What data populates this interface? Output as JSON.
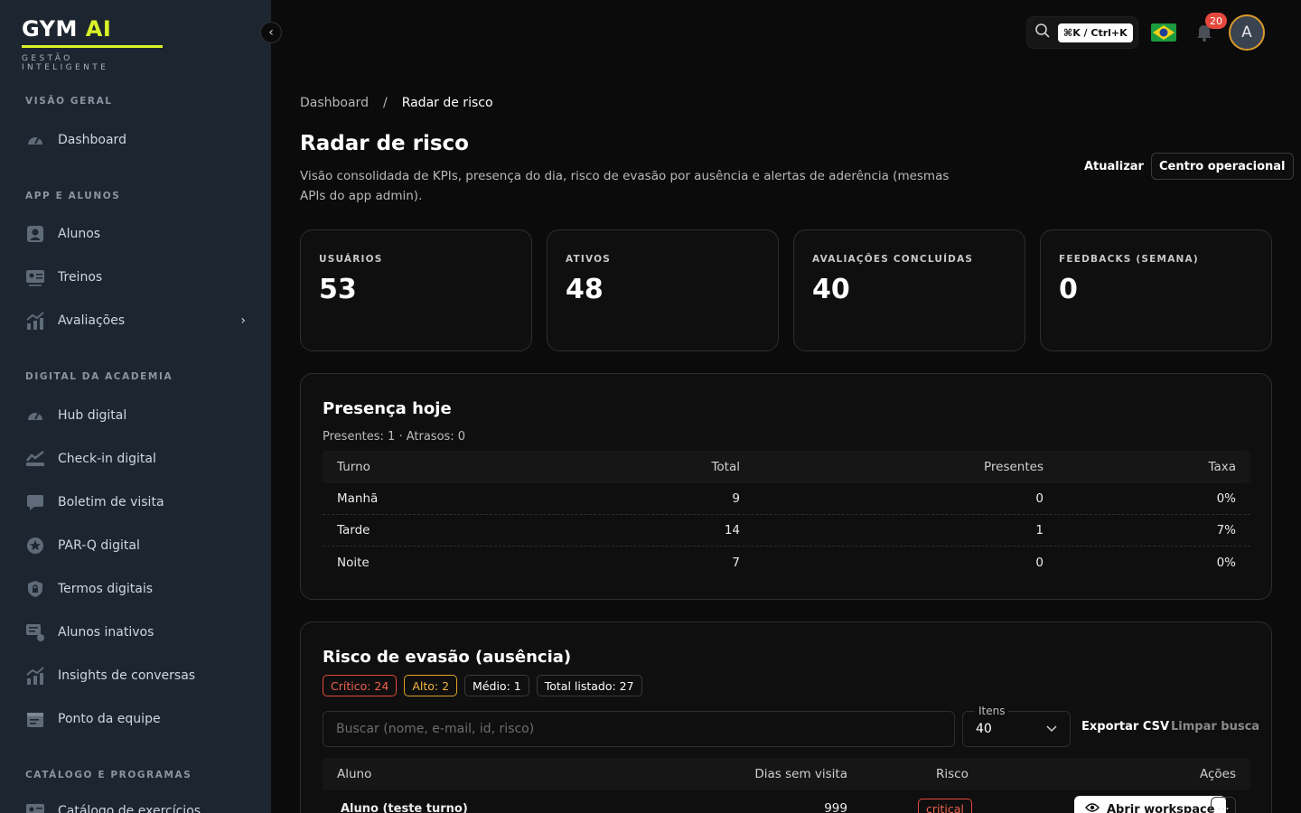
{
  "brand": {
    "name_main": "GYM",
    "name_accent": "AI",
    "tagline": "GESTÃO INTELIGENTE",
    "accent_color": "#d9f227"
  },
  "sidebar": {
    "collapse_icon": "‹",
    "sections": [
      {
        "title": "VISÃO GERAL",
        "items": [
          {
            "label": "Dashboard",
            "icon": "gauge-icon"
          }
        ]
      },
      {
        "title": "APP E ALUNOS",
        "items": [
          {
            "label": "Alunos",
            "icon": "user-icon"
          },
          {
            "label": "Treinos",
            "icon": "id-card-icon"
          },
          {
            "label": "Avaliações",
            "icon": "chart-icon",
            "has_submenu": true
          }
        ]
      },
      {
        "title": "DIGITAL DA ACADEMIA",
        "items": [
          {
            "label": "Hub digital",
            "icon": "gauge-icon"
          },
          {
            "label": "Check-in digital",
            "icon": "checkin-icon"
          },
          {
            "label": "Boletim de visita",
            "icon": "chat-icon"
          },
          {
            "label": "PAR-Q digital",
            "icon": "star-icon"
          },
          {
            "label": "Termos digitais",
            "icon": "lock-icon"
          },
          {
            "label": "Alunos inativos",
            "icon": "message-icon"
          },
          {
            "label": "Insights de conversas",
            "icon": "chart-icon"
          },
          {
            "label": "Ponto da equipe",
            "icon": "calendar-icon"
          }
        ]
      },
      {
        "title": "CATÁLOGO E PROGRAMAS",
        "items": [
          {
            "label": "Catálogo de exercícios",
            "icon": "id-card-icon"
          }
        ]
      }
    ]
  },
  "topbar": {
    "shortcut": "⌘K / Ctrl+K",
    "notifications": "20",
    "avatar_initial": "A"
  },
  "breadcrumb": {
    "root": "Dashboard",
    "separator": "/",
    "current": "Radar de risco"
  },
  "page": {
    "title": "Radar de risco",
    "description": "Visão consolidada de KPIs, presença do dia, risco de evasão por ausência e alertas de aderência (mesmas APIs do app admin).",
    "refresh_label": "Atualizar",
    "center_label": "Centro operacional"
  },
  "kpis": [
    {
      "label": "USUÁRIOS",
      "value": "53"
    },
    {
      "label": "ATIVOS",
      "value": "48"
    },
    {
      "label": "AVALIAÇÕES CONCLUÍDAS",
      "value": "40"
    },
    {
      "label": "FEEDBACKS (SEMANA)",
      "value": "0"
    }
  ],
  "presence": {
    "title": "Presença hoje",
    "summary": "Presentes: 1 · Atrasos: 0",
    "columns": [
      "Turno",
      "Total",
      "Presentes",
      "Taxa"
    ],
    "rows": [
      [
        "Manhã",
        "9",
        "0",
        "0%"
      ],
      [
        "Tarde",
        "14",
        "1",
        "7%"
      ],
      [
        "Noite",
        "7",
        "0",
        "0%"
      ]
    ]
  },
  "risk": {
    "title": "Risco de evasão (ausência)",
    "chips": {
      "critical": "Crítico: 24",
      "high": "Alto: 2",
      "medium": "Médio: 1",
      "total": "Total listado: 27"
    },
    "search_placeholder": "Buscar (nome, e-mail, id, risco)",
    "items_label": "Itens",
    "items_value": "40",
    "export_label": "Exportar CSV",
    "clear_label": "Limpar busca",
    "columns": [
      "Aluno",
      "Dias sem visita",
      "Risco",
      "Ações"
    ],
    "rows": [
      {
        "student": "Aluno (teste turno)",
        "days": "999",
        "risk": "critical",
        "action": "Abrir workspace",
        "more": "···"
      }
    ]
  }
}
